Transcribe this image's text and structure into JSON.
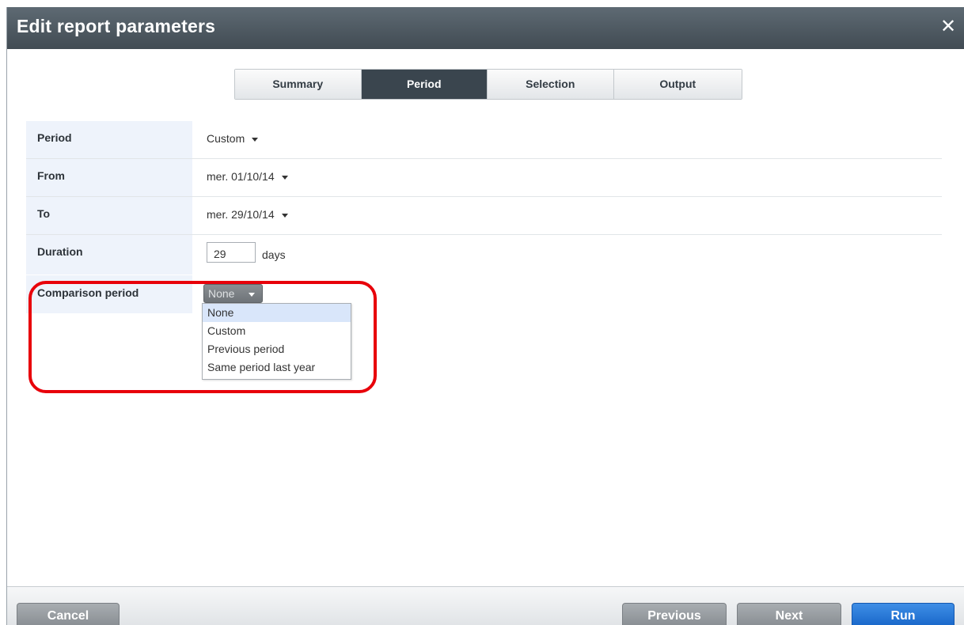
{
  "dialog": {
    "title": "Edit report parameters",
    "close_label": "✕"
  },
  "tabs": [
    {
      "label": "Summary",
      "active": false
    },
    {
      "label": "Period",
      "active": true
    },
    {
      "label": "Selection",
      "active": false
    },
    {
      "label": "Output",
      "active": false
    }
  ],
  "form": {
    "period": {
      "label": "Period",
      "value": "Custom"
    },
    "from": {
      "label": "From",
      "value": "mer. 01/10/14"
    },
    "to": {
      "label": "To",
      "value": "mer. 29/10/14"
    },
    "duration": {
      "label": "Duration",
      "value": "29",
      "unit": "days"
    },
    "comparison": {
      "label": "Comparison period",
      "selected": "None",
      "options": [
        "None",
        "Custom",
        "Previous period",
        "Same period last year"
      ]
    }
  },
  "footer": {
    "cancel_label": "Cancel",
    "previous_label": "Previous",
    "next_label": "Next",
    "run_label": "Run"
  },
  "colors": {
    "titlebar": "#4a555e",
    "active_tab": "#3a454e",
    "run_button": "#1f73d6",
    "highlight": "#e8000a"
  }
}
